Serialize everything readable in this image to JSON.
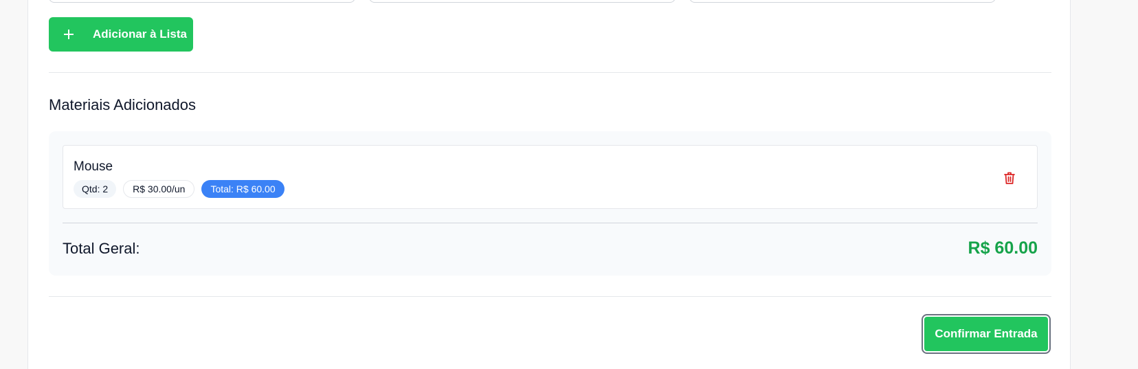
{
  "form": {
    "add_button_label": "Adicionar à Lista"
  },
  "materials": {
    "section_title": "Materiais Adicionados",
    "items": [
      {
        "name": "Mouse",
        "quantity_badge": "Qtd: 2",
        "unit_price_badge": "R$ 30.00/un",
        "total_badge": "Total: R$ 60.00"
      }
    ],
    "grand_total_label": "Total Geral:",
    "grand_total_value": "R$ 60.00"
  },
  "actions": {
    "confirm_label": "Confirmar Entrada"
  },
  "icons": {
    "add": "plus-icon",
    "remove": "trash-icon"
  },
  "colors": {
    "primary_green": "#22c55e",
    "total_green": "#16a34a",
    "total_badge_blue": "#3b82f6",
    "danger_red": "#dc2626"
  }
}
